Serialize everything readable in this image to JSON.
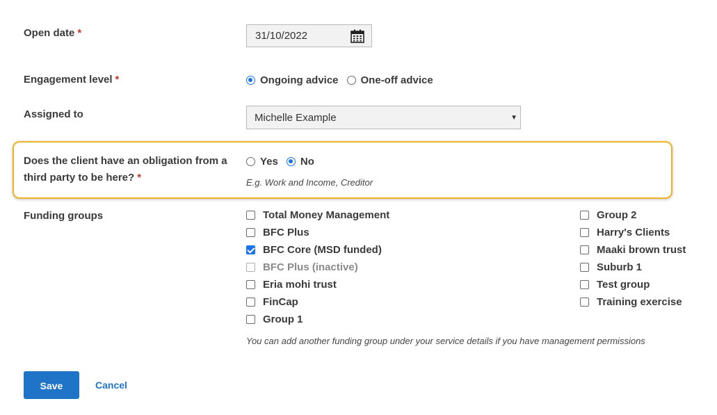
{
  "open_date": {
    "label": "Open date",
    "required": "*",
    "value": "31/10/2022",
    "icon": "calendar-icon"
  },
  "engagement": {
    "label": "Engagement level",
    "required": "*",
    "options": [
      {
        "label": "Ongoing advice",
        "selected": true
      },
      {
        "label": "One-off advice",
        "selected": false
      }
    ]
  },
  "assigned": {
    "label": "Assigned to",
    "value": "Michelle Example",
    "arrow": "▼"
  },
  "obligation": {
    "label_line1": "Does the client have an obligation from a",
    "label_line2": "third party to be here?",
    "required": "*",
    "options": [
      {
        "label": "Yes",
        "selected": false
      },
      {
        "label": "No",
        "selected": true
      }
    ],
    "hint": "E.g. Work and Income, Creditor",
    "highlight_color": "#f0b323"
  },
  "funding": {
    "label": "Funding groups",
    "col1": [
      {
        "label": "Total Money Management",
        "checked": false
      },
      {
        "label": "BFC Plus",
        "checked": false
      },
      {
        "label": "BFC Core (MSD funded)",
        "checked": true
      },
      {
        "label": "BFC Plus (inactive)",
        "checked": false,
        "inactive": true
      },
      {
        "label": "Eria mohi trust",
        "checked": false
      },
      {
        "label": "FinCap",
        "checked": false
      },
      {
        "label": "Group 1",
        "checked": false
      }
    ],
    "col2": [
      {
        "label": "Group 2",
        "checked": false
      },
      {
        "label": "Harry's Clients",
        "checked": false
      },
      {
        "label": "Maaki brown trust",
        "checked": false
      },
      {
        "label": "Suburb 1",
        "checked": false
      },
      {
        "label": "Test group",
        "checked": false
      },
      {
        "label": "Training exercise",
        "checked": false
      }
    ],
    "hint": "You can add another funding group under your service details if you have management permissions"
  },
  "actions": {
    "save": "Save",
    "cancel": "Cancel"
  },
  "colors": {
    "accent": "#1a73e8",
    "button": "#1f74c8",
    "required": "#c0392b"
  }
}
